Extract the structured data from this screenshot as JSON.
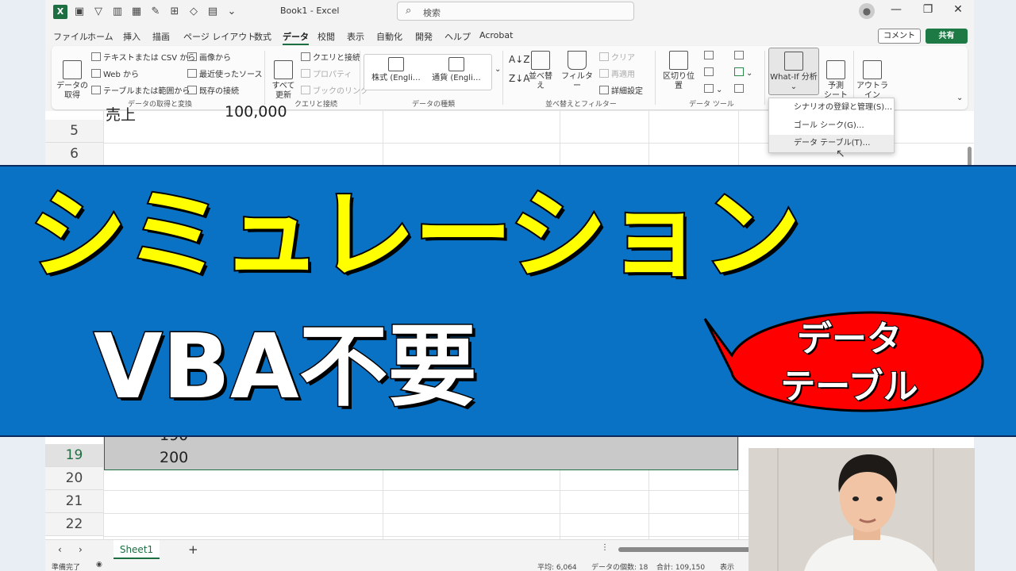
{
  "app": {
    "doc_title": "Book1 - Excel",
    "search_placeholder": "検索",
    "comment_label": "コメント",
    "share_label": "共有"
  },
  "menu": [
    "ファイル",
    "ホーム",
    "挿入",
    "描画",
    "ページ レイアウト",
    "数式",
    "データ",
    "校閲",
    "表示",
    "自動化",
    "開発",
    "ヘルプ",
    "Acrobat"
  ],
  "active_menu": "データ",
  "ribbon": {
    "get_data": "データの\n取得",
    "text_csv": "テキストまたは CSV から",
    "web": "Web から",
    "table_range": "テーブルまたは範囲から",
    "from_picture": "画像から",
    "recent_sources": "最近使ったソース",
    "existing_connections": "既存の接続",
    "group_get_transform": "データの取得と変換",
    "refresh_all": "すべて\n更新",
    "queries_connections": "クエリと接続",
    "properties": "プロパティ",
    "edit_links": "ブックのリンク",
    "group_queries": "クエリと接続",
    "stocks": "株式 (Engli…",
    "currencies": "通貨 (Engli…",
    "group_datatypes": "データの種類",
    "sort": "並べ替え",
    "filter": "フィルター",
    "clear": "クリア",
    "reapply": "再適用",
    "advanced": "詳細設定",
    "group_sort_filter": "並べ替えとフィルター",
    "text_to_columns": "区切り位置",
    "group_data_tools": "データ ツール",
    "whatif": "What-If 分析",
    "forecast": "予測\nシート",
    "outline": "アウトラ\nイン"
  },
  "whatif_menu": [
    "シナリオの登録と管理(S)…",
    "ゴール シーク(G)…",
    "データ テーブル(T)…"
  ],
  "grid": {
    "row_numbers_top": [
      "5",
      "6"
    ],
    "row_numbers_bottom": [
      "19",
      "20",
      "21",
      "22"
    ],
    "cell_b4_partial": "売上",
    "cell_c4_partial": "100,000",
    "cell_b18_partial": "190",
    "cell_b19": "200"
  },
  "sheet_tab": "Sheet1",
  "status": {
    "ready": "準備完了",
    "average": "平均: 6,064",
    "count": "データの個数: 18",
    "sum": "合計: 109,150",
    "display": "表示"
  },
  "overlay": {
    "headline": "シミュレーション",
    "subheadline": "VBA不要",
    "bubble_line1": "データ",
    "bubble_line2": "テーブル"
  },
  "colors": {
    "banner_blue": "#0a72c4",
    "headline_yellow": "#ffff00",
    "bubble_red": "#ff0000",
    "excel_green": "#1d6f42"
  }
}
